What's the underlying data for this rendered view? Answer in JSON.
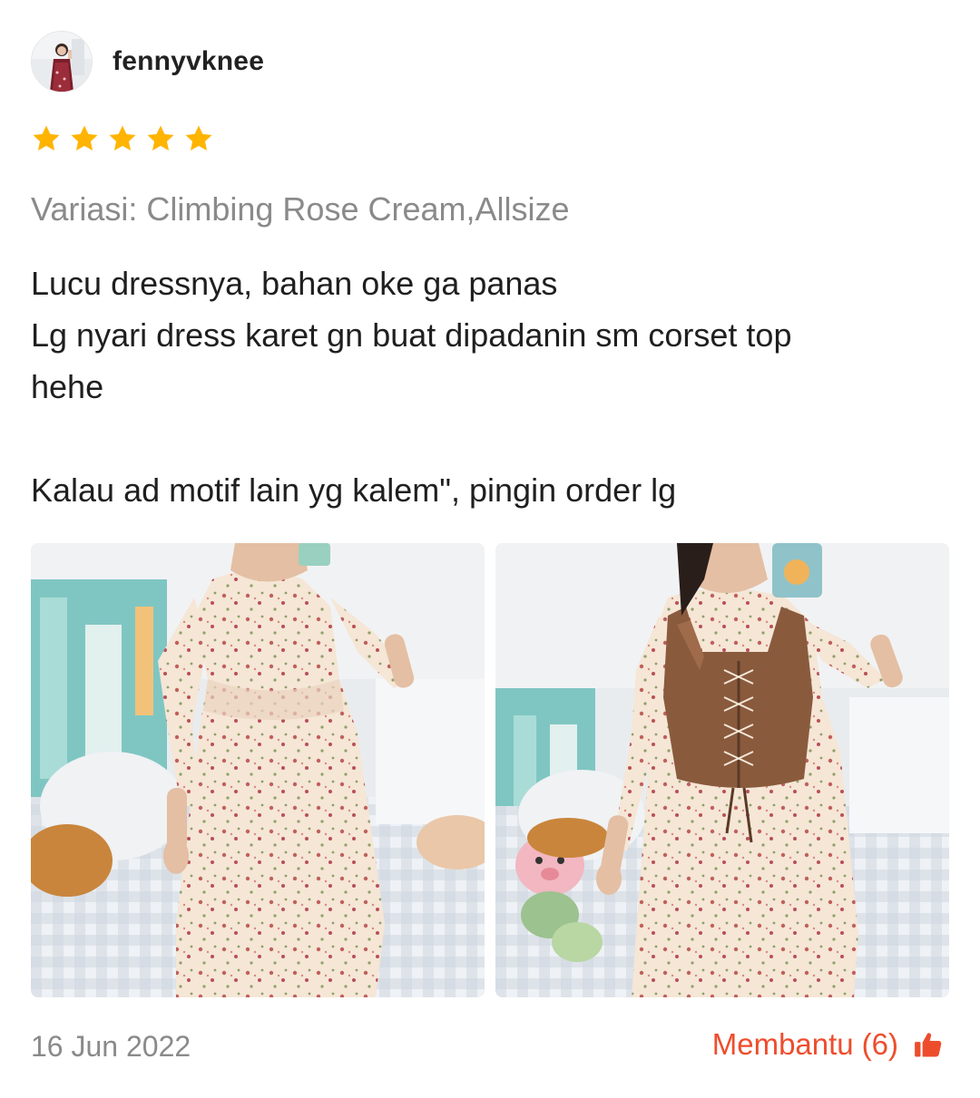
{
  "review": {
    "username": "fennyvknee",
    "rating": 5,
    "rating_max": 5,
    "variation": "Variasi: Climbing Rose Cream,Allsize",
    "body_lines": [
      "Lucu dressnya, bahan oke ga panas",
      "Lg nyari dress karet gn buat dipadanin sm corset top",
      "hehe",
      "",
      "Kalau ad motif lain yg kalem\", pingin order lg"
    ],
    "photos": [
      {
        "icon": "photo-floral-dress"
      },
      {
        "icon": "photo-floral-dress-with-corset"
      }
    ],
    "date": "16 Jun 2022",
    "helpful_label": "Membantu",
    "helpful_count": "(6)"
  },
  "colors": {
    "star": "#ffb400",
    "accent": "#ee4d2d",
    "muted_text": "#8a8a8a",
    "text": "#222222"
  },
  "icons": {
    "star": "star-icon",
    "helpful": "thumbs-up-icon",
    "avatar": "avatar"
  }
}
